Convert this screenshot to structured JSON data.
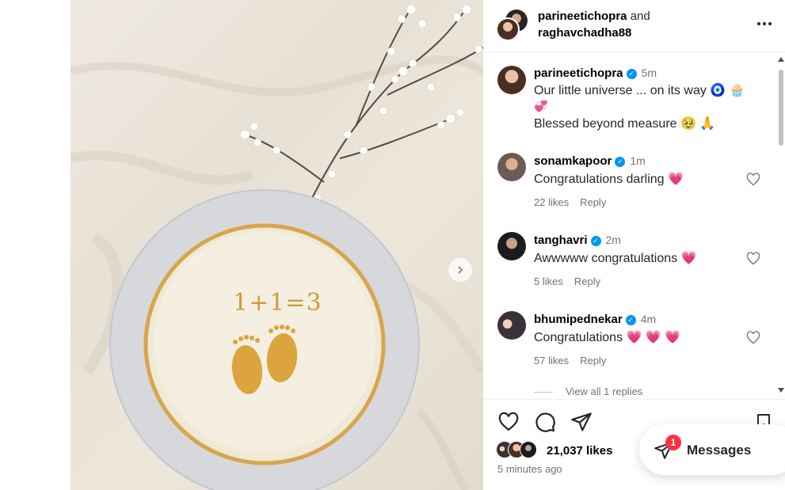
{
  "post": {
    "authors": {
      "primary": "parineetichopra",
      "joiner": "and",
      "secondary": "raghavchadha88"
    },
    "caption": {
      "username": "parineetichopra",
      "verified": true,
      "time": "5m",
      "line1": "Our little universe ... on its way 🧿 🧁",
      "line1_extra": "💞",
      "line2": "Blessed beyond measure 🥹 🙏"
    },
    "comments": [
      {
        "username": "sonamkapoor",
        "verified": true,
        "time": "1m",
        "text": "Congratulations darling",
        "hearts": "💗",
        "likes": "22 likes",
        "reply": "Reply"
      },
      {
        "username": "tanghavri",
        "verified": true,
        "time": "2m",
        "text": "Awwwww congratulations",
        "hearts": "💗",
        "likes": "5 likes",
        "reply": "Reply"
      },
      {
        "username": "bhumipednekar",
        "verified": true,
        "time": "4m",
        "text": "Congratulations",
        "hearts": "💗 💗 💗",
        "likes": "57 likes",
        "reply": "Reply"
      }
    ],
    "view_replies": "View all 1 replies",
    "likes": "21,037 likes",
    "posted": "5 minutes ago",
    "cake_text": "1+1=3"
  },
  "messages": {
    "label": "Messages",
    "badge": "1"
  },
  "icons": {
    "more": "more-options-icon",
    "like": "heart-icon",
    "comment": "comment-icon",
    "share": "share-icon",
    "save": "bookmark-icon",
    "next": "chevron-right-icon",
    "messages": "paper-plane-icon"
  },
  "colors": {
    "verified": "#0095f6",
    "badge": "#ff3040",
    "heart": "#e8336b",
    "muted": "#737373"
  }
}
